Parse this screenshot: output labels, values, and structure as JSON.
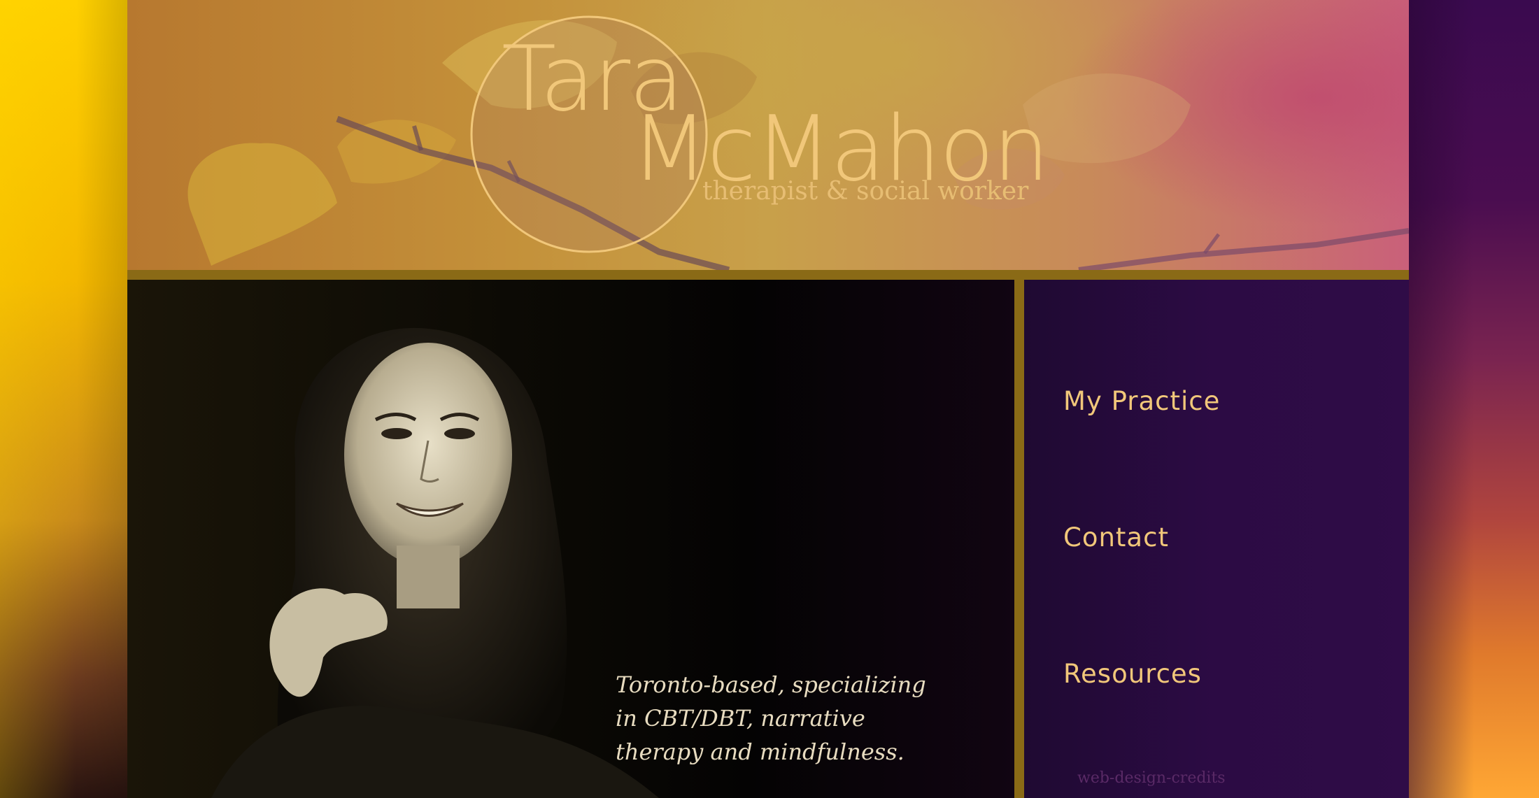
{
  "header": {
    "name_first": "Tara",
    "name_last": "McMahon",
    "subtitle": "therapist & social worker"
  },
  "hero": {
    "tagline": "Toronto-based, specializing in CBT/DBT, narrative therapy and mindfulness."
  },
  "nav": {
    "items": [
      {
        "label": "My Practice"
      },
      {
        "label": "Contact"
      },
      {
        "label": "Resources"
      }
    ],
    "credits": "web-design-credits"
  },
  "colors": {
    "accent_gold": "#f1c77a",
    "divider_gold": "#8a6a16",
    "nav_purple": "#2c0b44"
  }
}
